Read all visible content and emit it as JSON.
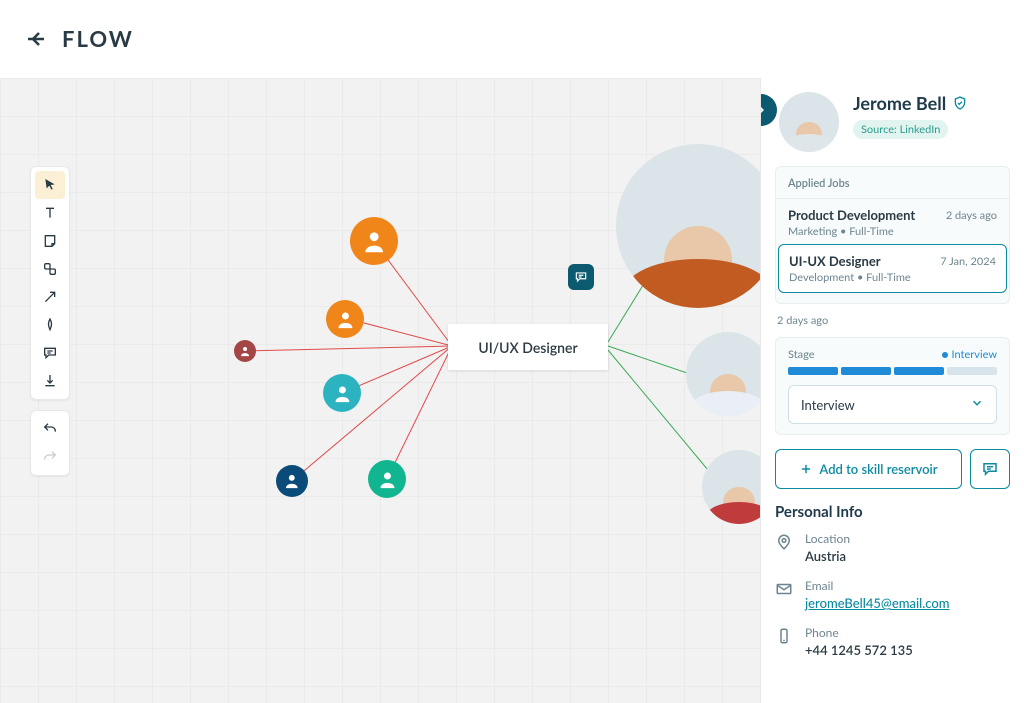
{
  "header": {
    "title": "FLOW"
  },
  "canvas": {
    "center_label": "UI/UX Designer"
  },
  "profile": {
    "name": "Jerome Bell",
    "source_label": "Source: LinkedIn"
  },
  "applied_jobs": {
    "section_title": "Applied Jobs",
    "items": [
      {
        "title": "Product Development",
        "subline": "Marketing  •  Full-Time",
        "date": "2 days ago"
      },
      {
        "title": "UI-UX Designer",
        "subline": "Development  •  Full-Time",
        "date": "7 Jan, 2024"
      }
    ]
  },
  "ago_text": "2 days ago",
  "stage": {
    "label": "Stage",
    "value": "Interview",
    "filled": 3,
    "total": 4,
    "dropdown": "Interview"
  },
  "actions": {
    "add_label": "Add to skill reservoir"
  },
  "personal_info": {
    "section_title": "Personal Info",
    "location_label": "Location",
    "location_value": "Austria",
    "email_label": "Email",
    "email_value": "jeromeBell45@email.com",
    "phone_label": "Phone",
    "phone_value": "+44 1245 572 135"
  }
}
